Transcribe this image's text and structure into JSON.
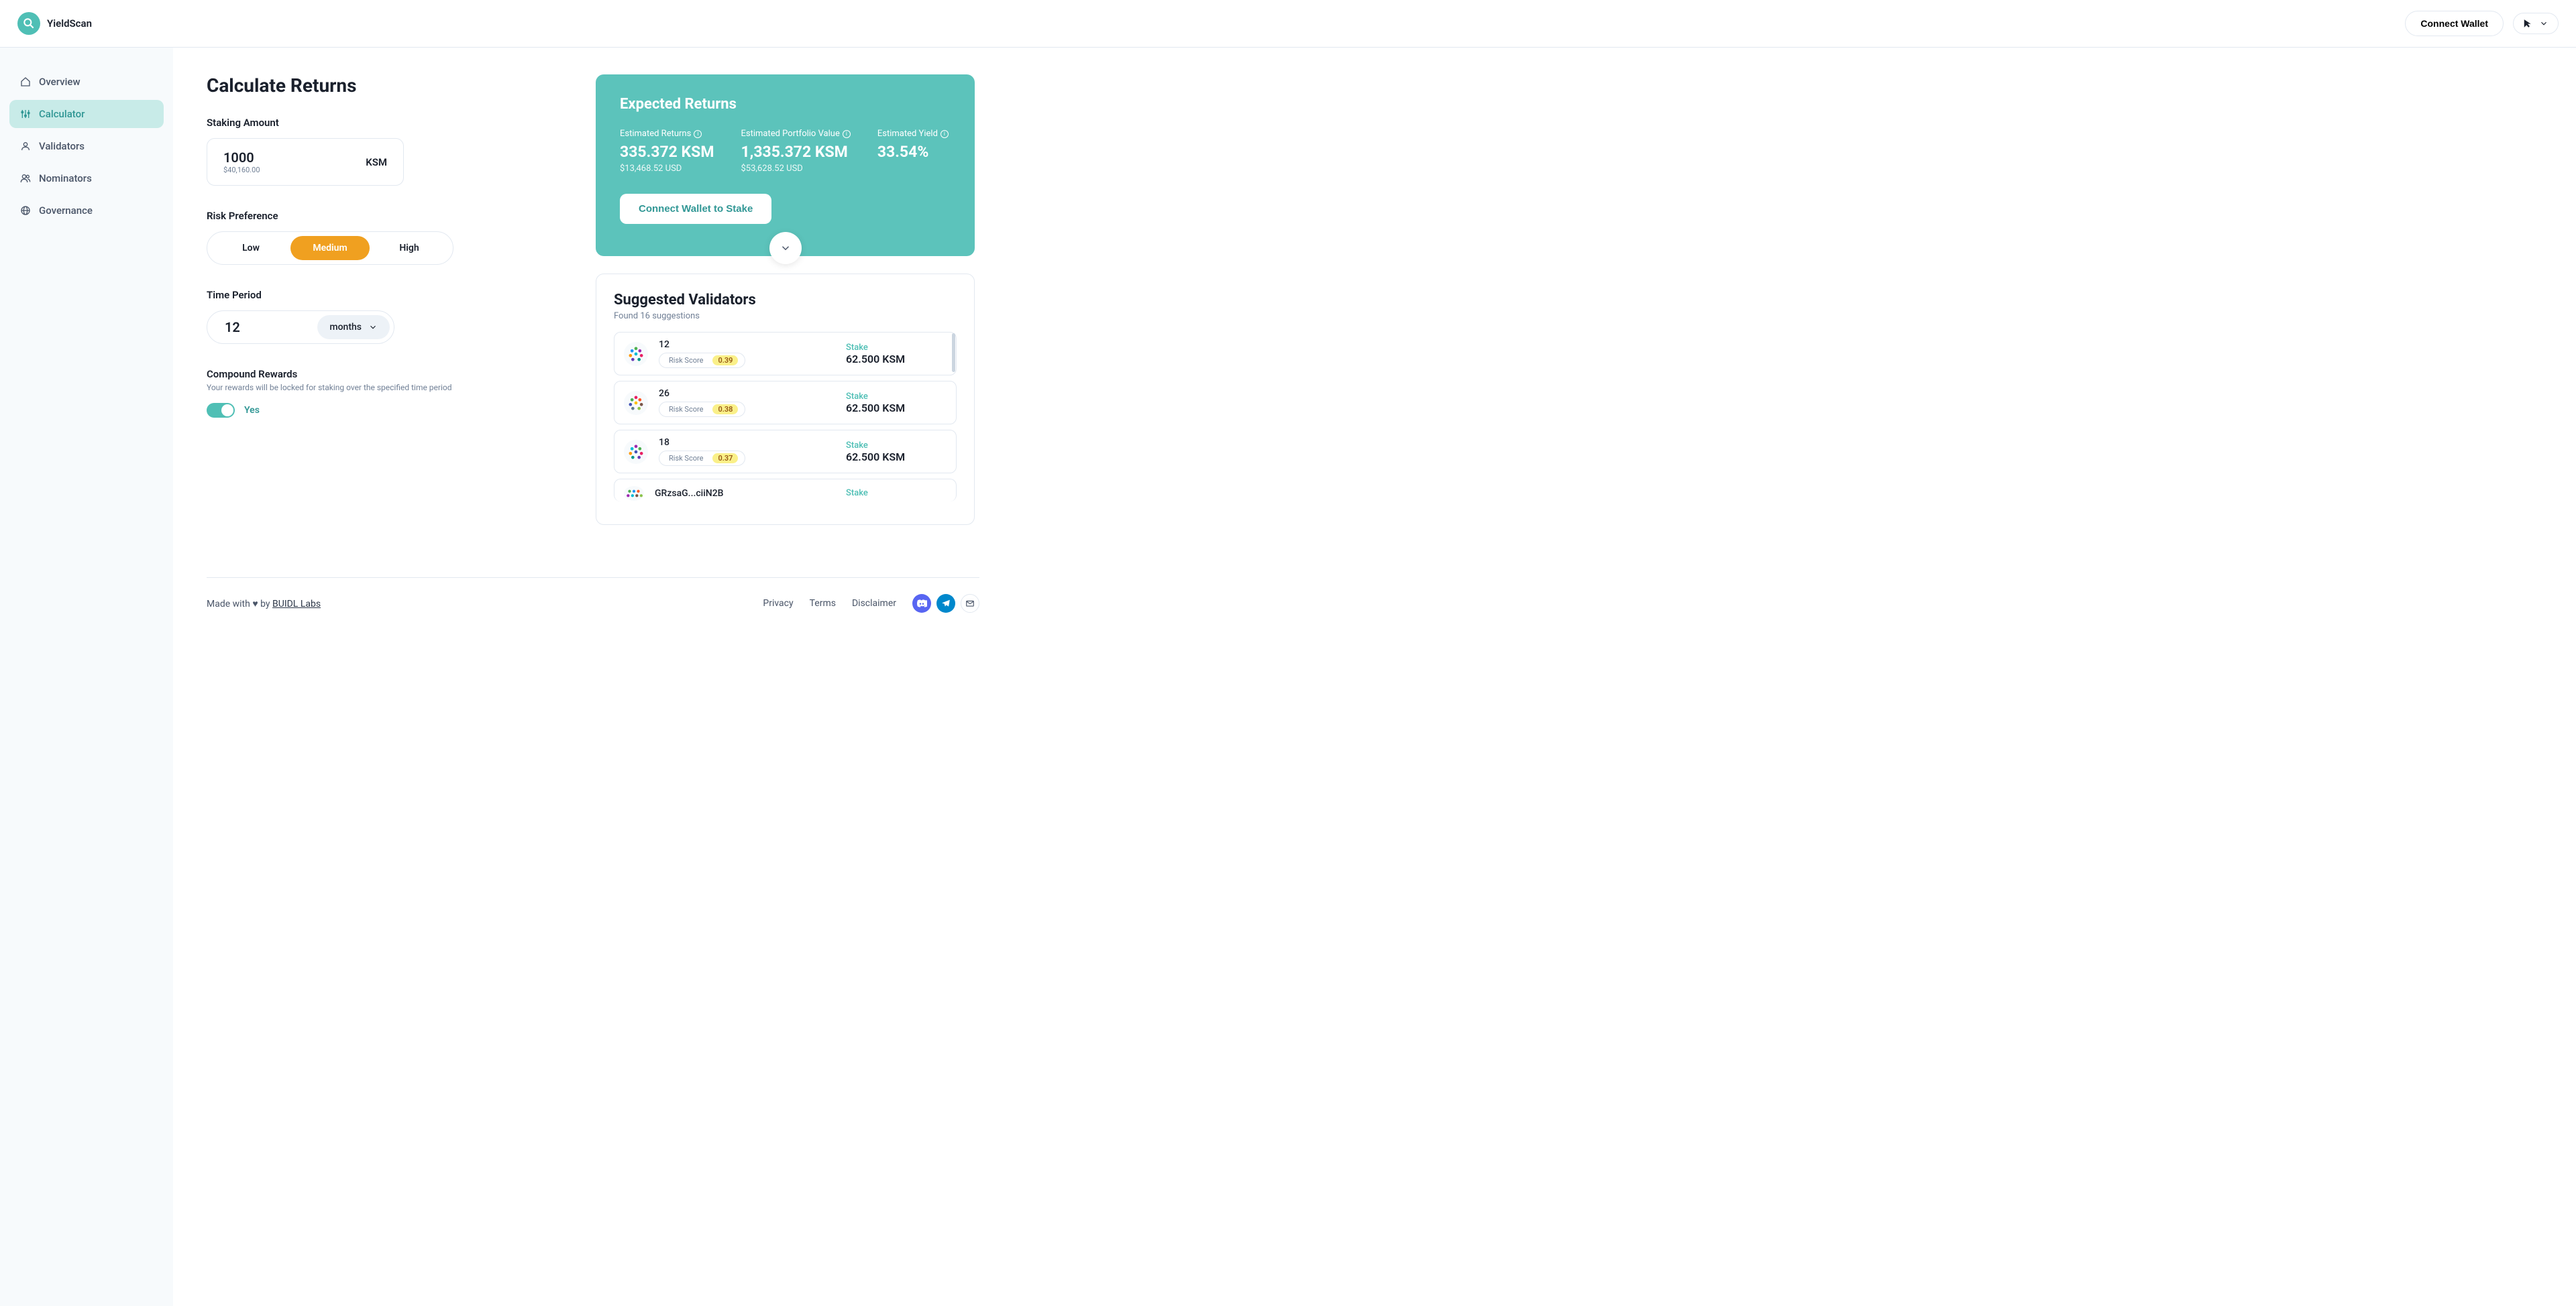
{
  "app_name": "YieldScan",
  "header": {
    "connect_wallet": "Connect Wallet"
  },
  "sidebar": {
    "items": [
      {
        "label": "Overview"
      },
      {
        "label": "Calculator"
      },
      {
        "label": "Validators"
      },
      {
        "label": "Nominators"
      },
      {
        "label": "Governance"
      }
    ]
  },
  "calc": {
    "title": "Calculate Returns",
    "staking_label": "Staking Amount",
    "amount": "1000",
    "amount_usd": "$40,160.00",
    "ticker": "KSM",
    "risk_label": "Risk Preference",
    "risk_options": {
      "low": "Low",
      "medium": "Medium",
      "high": "High"
    },
    "time_label": "Time Period",
    "time_value": "12",
    "time_unit": "months",
    "compound_label": "Compound Rewards",
    "compound_sub": "Your rewards will be locked for staking over the specified time period",
    "compound_toggle": "Yes"
  },
  "expected": {
    "title": "Expected Returns",
    "returns_label": "Estimated Returns",
    "returns_value": "335.372 KSM",
    "returns_usd": "$13,468.52 USD",
    "portfolio_label": "Estimated Portfolio Value",
    "portfolio_value": "1,335.372 KSM",
    "portfolio_usd": "$53,628.52 USD",
    "yield_label": "Estimated Yield",
    "yield_value": "33.54%",
    "stake_btn": "Connect Wallet to Stake"
  },
  "validators": {
    "title": "Suggested Validators",
    "subtitle": "Found 16 suggestions",
    "risk_label": "Risk Score",
    "stake_label": "Stake",
    "items": [
      {
        "name": "12",
        "risk": "0.39",
        "stake": "62.500 KSM"
      },
      {
        "name": "26",
        "risk": "0.38",
        "stake": "62.500 KSM"
      },
      {
        "name": "18",
        "risk": "0.37",
        "stake": "62.500 KSM"
      },
      {
        "name": "GRzsaG...ciiN2B",
        "risk": "",
        "stake": ""
      }
    ]
  },
  "footer": {
    "made": "Made with ",
    "by": " by ",
    "author": "BUIDL Labs",
    "privacy": "Privacy",
    "terms": "Terms",
    "disclaimer": "Disclaimer"
  }
}
